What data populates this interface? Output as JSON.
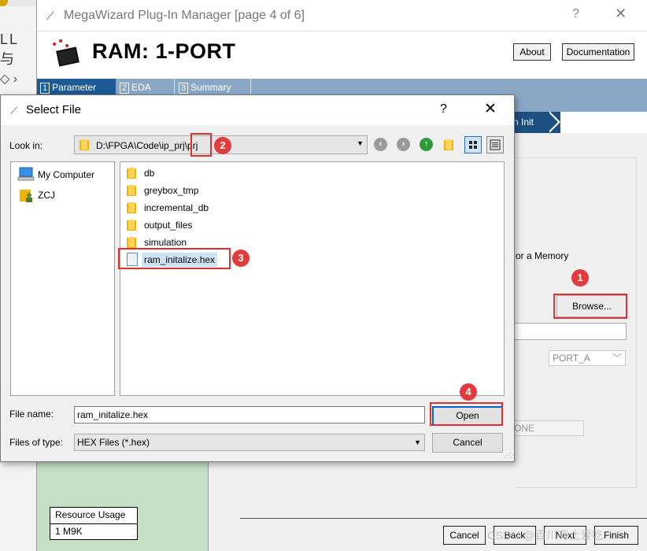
{
  "background": {
    "partial_text": "LL 与"
  },
  "wizard": {
    "title": "MegaWizard Plug-In Manager [page 4 of 6]",
    "help_glyph": "?",
    "close_glyph": "✕",
    "heading": "RAM: 1-PORT",
    "about_label": "About",
    "documentation_label": "Documentation",
    "tabs": [
      {
        "num": "1",
        "label": "Parameter"
      },
      {
        "num": "2",
        "label": "EDA"
      },
      {
        "num": "3",
        "label": "Summary"
      }
    ],
    "step_label": "n Init",
    "memory_text": "or a Memory",
    "browse_label": "Browse...",
    "port_select": "PORT_A",
    "one_field": "ONE",
    "resource_usage_header": "Resource Usage",
    "resource_usage_value": "1 M9K",
    "cancel_label": "Cancel",
    "back_label": "Back",
    "next_label": "Next",
    "finish_label": "Finish",
    "watermark": "CSDN @百川有土爱吃",
    "colors": {
      "tab_active": "#1d5a96",
      "tab_bar": "#8aa8c6",
      "green_panel": "#c6e0c6"
    }
  },
  "dialog": {
    "title": "Select File",
    "help_glyph": "?",
    "close_glyph": "✕",
    "look_in_label": "Look in:",
    "look_in_path": "D:\\FPGA\\Code\\ip_prj\\prj",
    "places": [
      {
        "icon": "computer-icon",
        "label": "My Computer"
      },
      {
        "icon": "user-folder-icon",
        "label": "ZCJ"
      }
    ],
    "files": [
      {
        "type": "folder",
        "name": "db"
      },
      {
        "type": "folder",
        "name": "greybox_tmp"
      },
      {
        "type": "folder",
        "name": "incremental_db"
      },
      {
        "type": "folder",
        "name": "output_files"
      },
      {
        "type": "folder",
        "name": "simulation"
      },
      {
        "type": "file",
        "name": "ram_initalize.hex"
      }
    ],
    "file_name_label": "File name:",
    "file_name_value": "ram_initalize.hex",
    "files_of_type_label": "Files of type:",
    "files_of_type_value": "HEX Files (*.hex)",
    "open_label": "Open",
    "cancel_label": "Cancel"
  },
  "annotations": [
    "1",
    "2",
    "3",
    "4"
  ],
  "annotation_color": "#e03030"
}
